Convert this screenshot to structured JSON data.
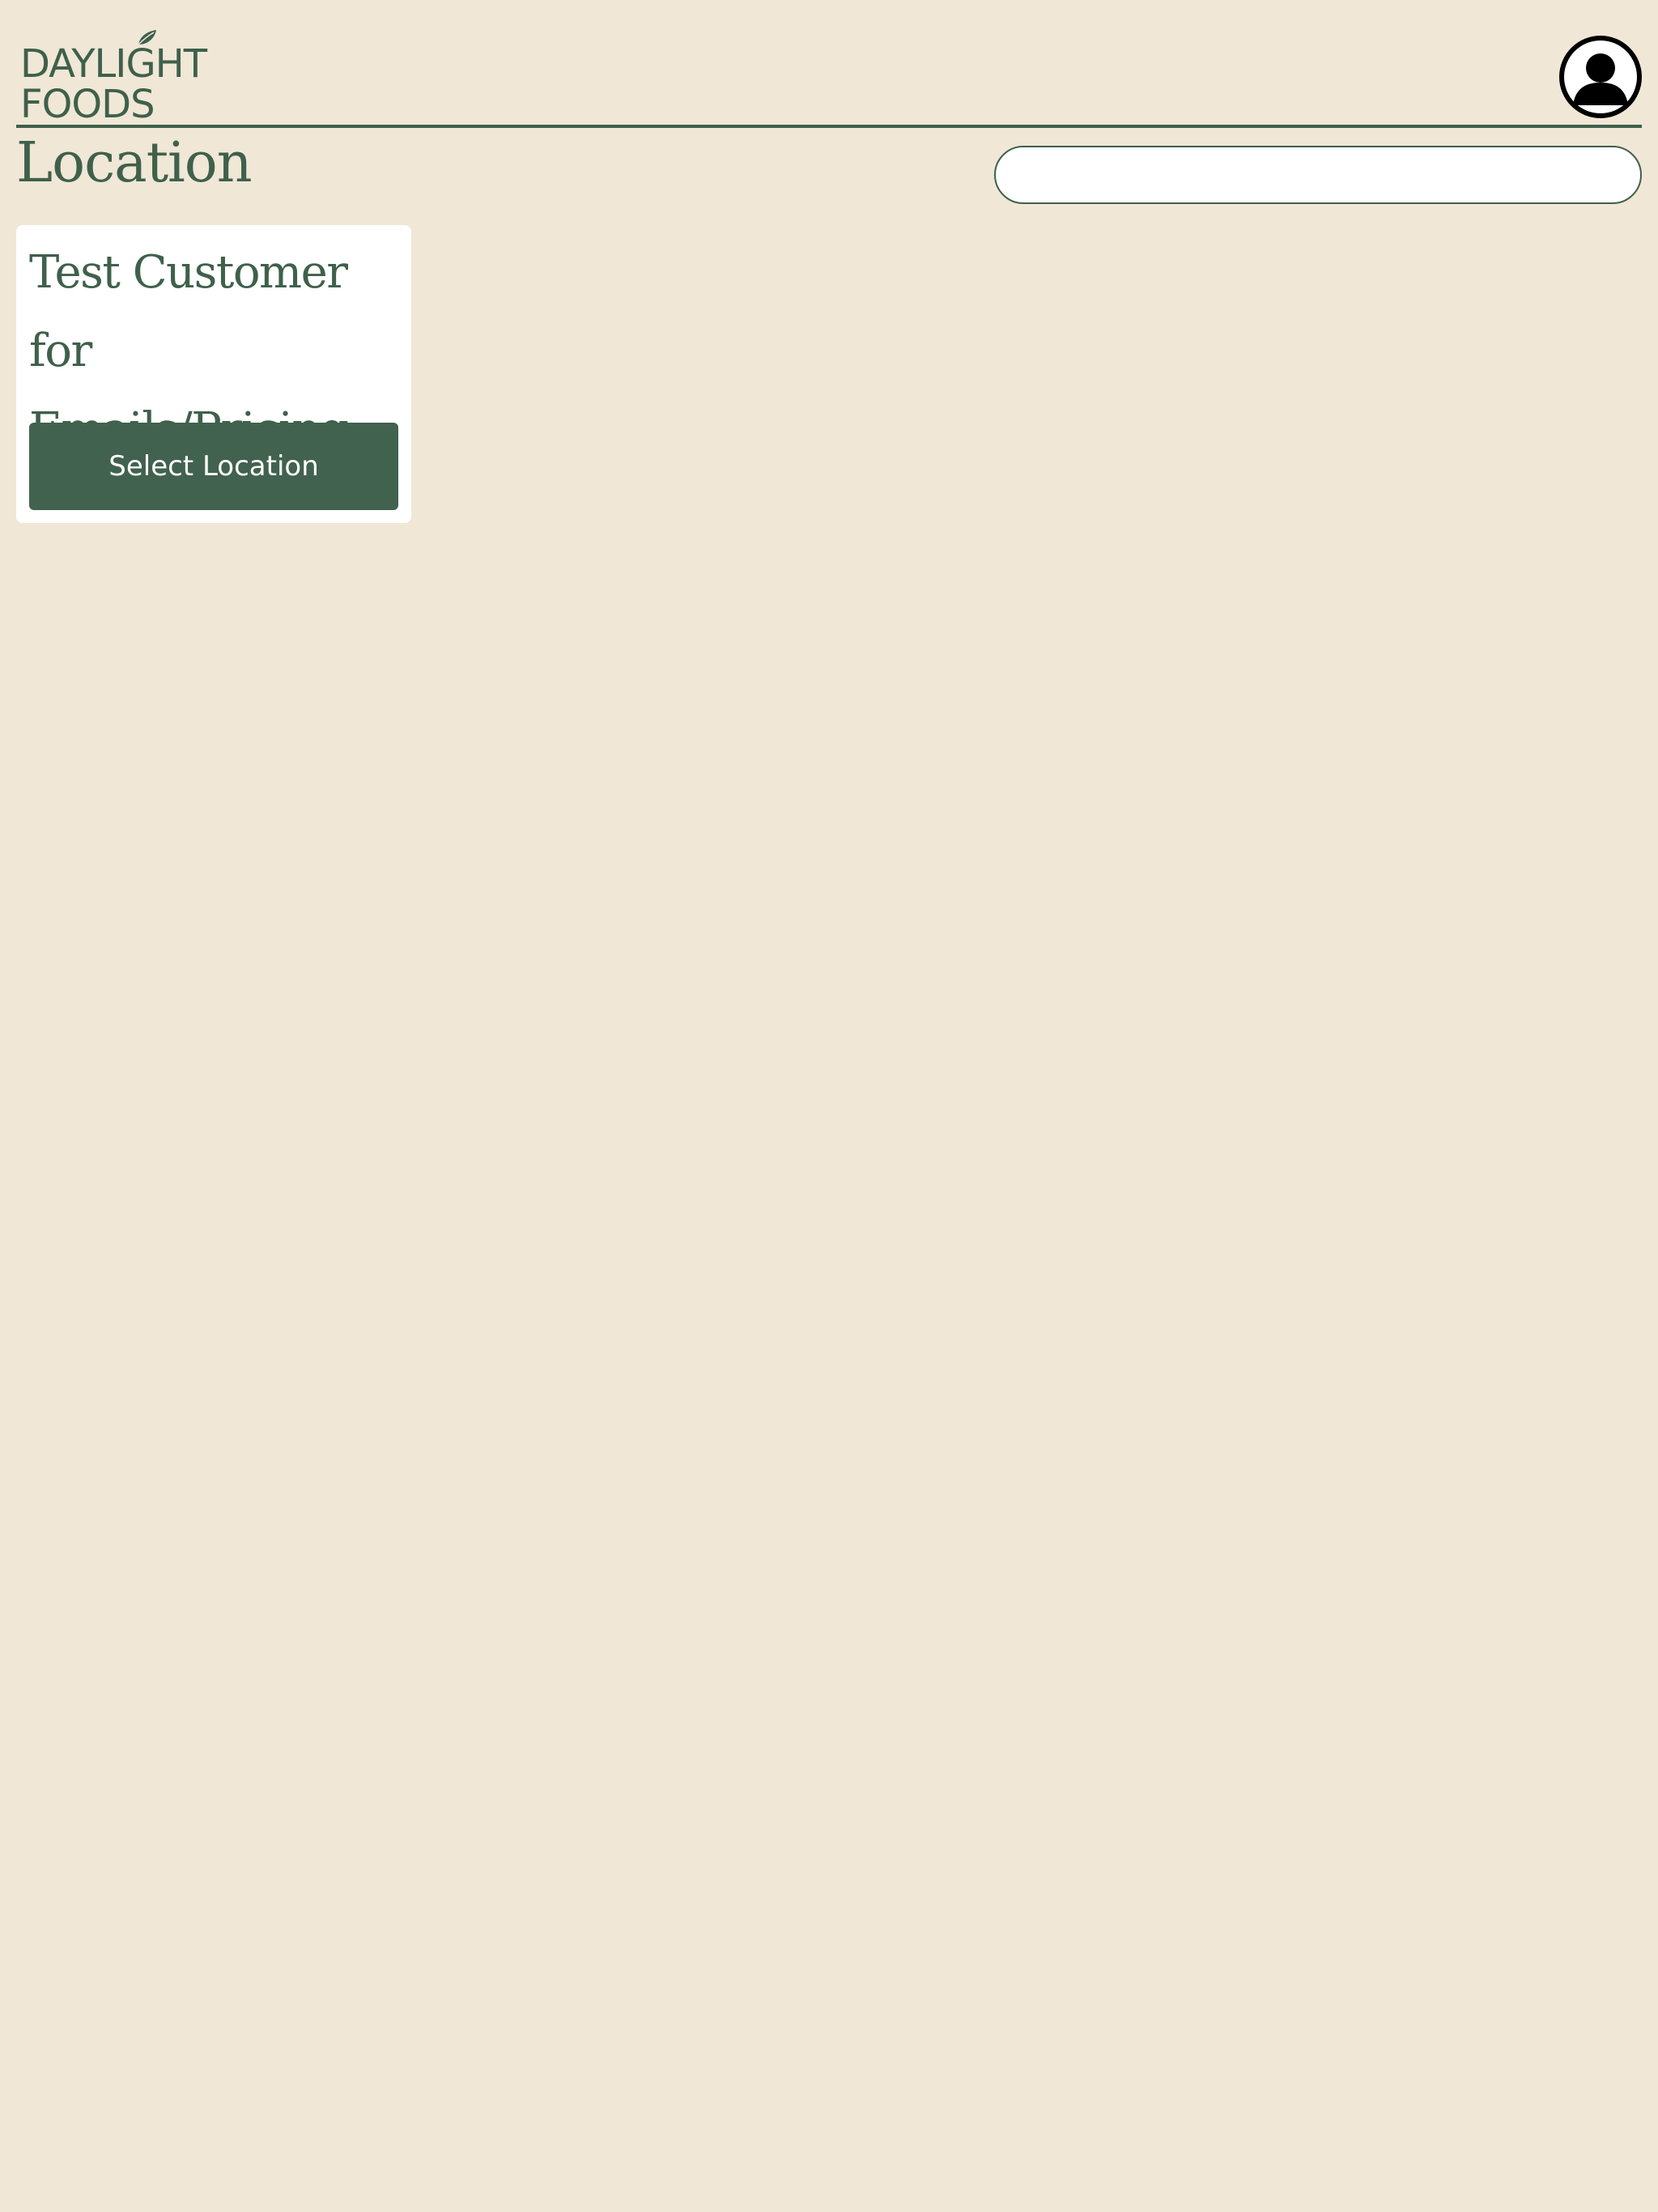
{
  "header": {
    "logo": {
      "line1": "DAYLIGHT",
      "line2": "FOODS"
    },
    "avatar_icon": "user-avatar-icon"
  },
  "page": {
    "title": "Location"
  },
  "search": {
    "value": "",
    "placeholder": ""
  },
  "locations": [
    {
      "name": "Test Customer for Emails/Pricing",
      "button_label": "Select Location"
    }
  ],
  "colors": {
    "background": "#f0e7d6",
    "brand_green": "#3f604b",
    "button_green": "#41624e",
    "card_bg": "#ffffff"
  }
}
